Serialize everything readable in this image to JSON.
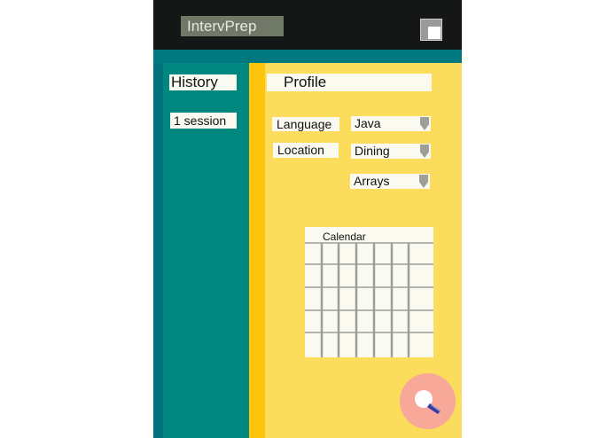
{
  "header": {
    "app_title": "IntervPrep"
  },
  "sidebar": {
    "title": "History",
    "session_count": "1 session"
  },
  "profile": {
    "title": "Profile",
    "language_label": "Language",
    "language_value": "Java",
    "location_label": "Location",
    "location_value": "Dining",
    "topic_value": "Arrays"
  },
  "calendar": {
    "title": "Calendar"
  },
  "colors": {
    "topbar": "#151717",
    "teal": "#008880",
    "yellow": "#fcdc5c",
    "accent_yellow": "#fcc40c",
    "fab": "#f8a898"
  },
  "icons": {
    "window_button": "window-restore-icon",
    "dropdown_arrow": "chevron-down-icon",
    "fab": "search-icon"
  }
}
